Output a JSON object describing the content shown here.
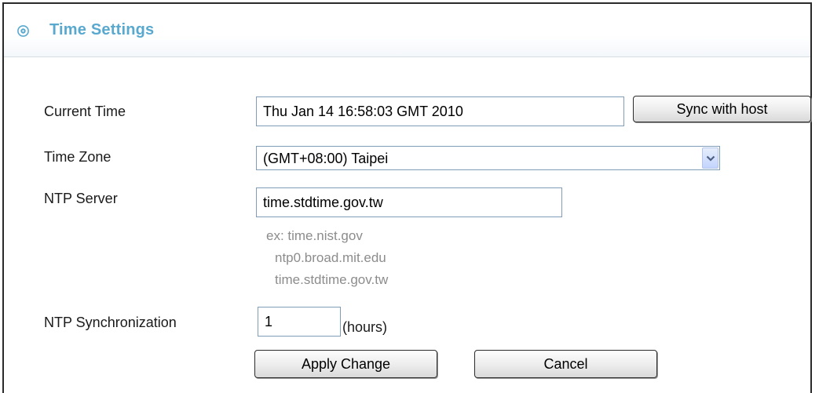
{
  "header": {
    "title": "Time Settings",
    "icon": "target-icon",
    "accent_color": "#59a9cf"
  },
  "form": {
    "current_time": {
      "label": "Current Time",
      "value": "Thu Jan 14 16:58:03 GMT 2010",
      "sync_button": "Sync with host"
    },
    "time_zone": {
      "label": "Time Zone",
      "selected": "(GMT+08:00) Taipei"
    },
    "ntp_server": {
      "label": "NTP Server",
      "value": "time.stdtime.gov.tw",
      "examples": [
        "ex: time.nist.gov",
        "ntp0.broad.mit.edu",
        "time.stdtime.gov.tw"
      ]
    },
    "ntp_sync": {
      "label": "NTP Synchronization",
      "value": "1",
      "unit": "(hours)"
    }
  },
  "actions": {
    "apply": "Apply Change",
    "cancel": "Cancel"
  }
}
